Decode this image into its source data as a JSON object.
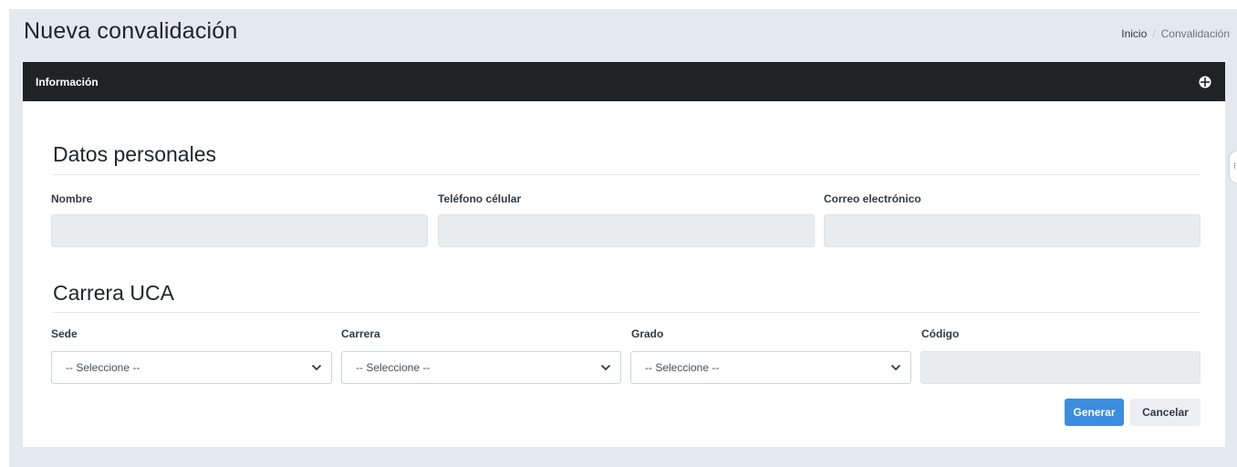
{
  "header": {
    "title": "Nueva convalidación",
    "breadcrumb": {
      "home": "Inicio",
      "separator": "/",
      "current": "Convalidación"
    }
  },
  "card": {
    "title": "Información",
    "tool_icon": "crosshair-circle-icon"
  },
  "personal": {
    "section_title": "Datos personales",
    "nombre_label": "Nombre",
    "nombre_value": "",
    "telefono_label": "Teléfono célular",
    "telefono_value": "",
    "correo_label": "Correo electrónico",
    "correo_value": ""
  },
  "carrera": {
    "section_title": "Carrera UCA",
    "sede_label": "Sede",
    "sede_selected": "-- Seleccione --",
    "carrera_label": "Carrera",
    "carrera_selected": "-- Seleccione --",
    "grado_label": "Grado",
    "grado_selected": "-- Seleccione --",
    "codigo_label": "Código",
    "codigo_value": ""
  },
  "actions": {
    "generate_label": "Generar",
    "cancel_label": "Cancelar"
  },
  "side_handle": {
    "glyph": "⁝"
  },
  "colors": {
    "header_bar": "#1f2326",
    "page_bg": "#e4e9f0",
    "primary": "#3c8dde",
    "readonly_input": "#e9ecef"
  }
}
